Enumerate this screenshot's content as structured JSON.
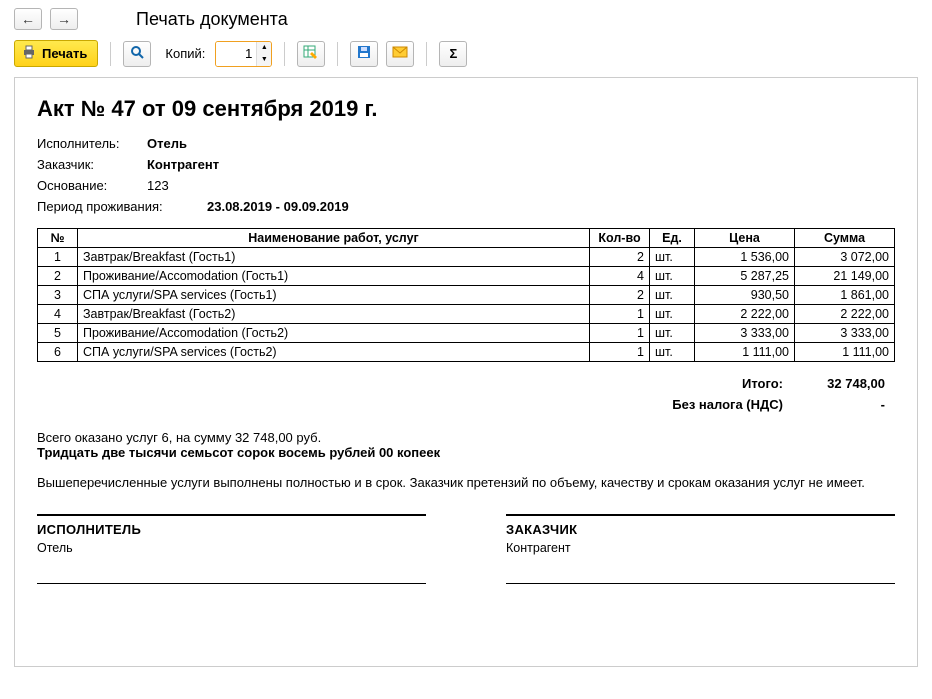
{
  "pageTitle": "Печать документа",
  "toolbar": {
    "printLabel": "Печать",
    "copiesLabel": "Копий:",
    "copiesValue": "1"
  },
  "doc": {
    "title": "Акт № 47 от 09 сентября 2019 г.",
    "executorLabel": "Исполнитель:",
    "executor": "Отель",
    "customerLabel": "Заказчик:",
    "customer": "Контрагент",
    "basisLabel": "Основание:",
    "basis": "123",
    "periodLabel": "Период проживания:",
    "period": "23.08.2019 - 09.09.2019"
  },
  "tableHeaders": {
    "num": "№",
    "name": "Наименование работ, услуг",
    "qty": "Кол-во",
    "unit": "Ед.",
    "price": "Цена",
    "sum": "Сумма"
  },
  "rows": [
    {
      "num": "1",
      "name": "Завтрак/Breakfast (Гость1)",
      "qty": "2",
      "unit": "шт.",
      "price": "1 536,00",
      "sum": "3 072,00"
    },
    {
      "num": "2",
      "name": "Проживание/Accomodation (Гость1)",
      "qty": "4",
      "unit": "шт.",
      "price": "5 287,25",
      "sum": "21 149,00"
    },
    {
      "num": "3",
      "name": "СПА услуги/SPA services (Гость1)",
      "qty": "2",
      "unit": "шт.",
      "price": "930,50",
      "sum": "1 861,00"
    },
    {
      "num": "4",
      "name": "Завтрак/Breakfast (Гость2)",
      "qty": "1",
      "unit": "шт.",
      "price": "2 222,00",
      "sum": "2 222,00"
    },
    {
      "num": "5",
      "name": "Проживание/Accomodation (Гость2)",
      "qty": "1",
      "unit": "шт.",
      "price": "3 333,00",
      "sum": "3 333,00"
    },
    {
      "num": "6",
      "name": "СПА услуги/SPA services (Гость2)",
      "qty": "1",
      "unit": "шт.",
      "price": "1 111,00",
      "sum": "1 111,00"
    }
  ],
  "totals": {
    "totalLabel": "Итого:",
    "totalValue": "32 748,00",
    "taxLabel": "Без налога (НДС)",
    "taxValue": "-"
  },
  "summary": {
    "line": "Всего оказано услуг 6, на сумму 32 748,00 руб.",
    "words": "Тридцать две тысячи семьсот сорок восемь рублей 00 копеек",
    "note": "Вышеперечисленные услуги выполнены полностью и в срок. Заказчик претензий по объему, качеству и срокам оказания услуг не имеет."
  },
  "sign": {
    "executorRole": "ИСПОЛНИТЕЛЬ",
    "executorName": "Отель",
    "customerRole": "ЗАКАЗЧИК",
    "customerName": "Контрагент"
  }
}
